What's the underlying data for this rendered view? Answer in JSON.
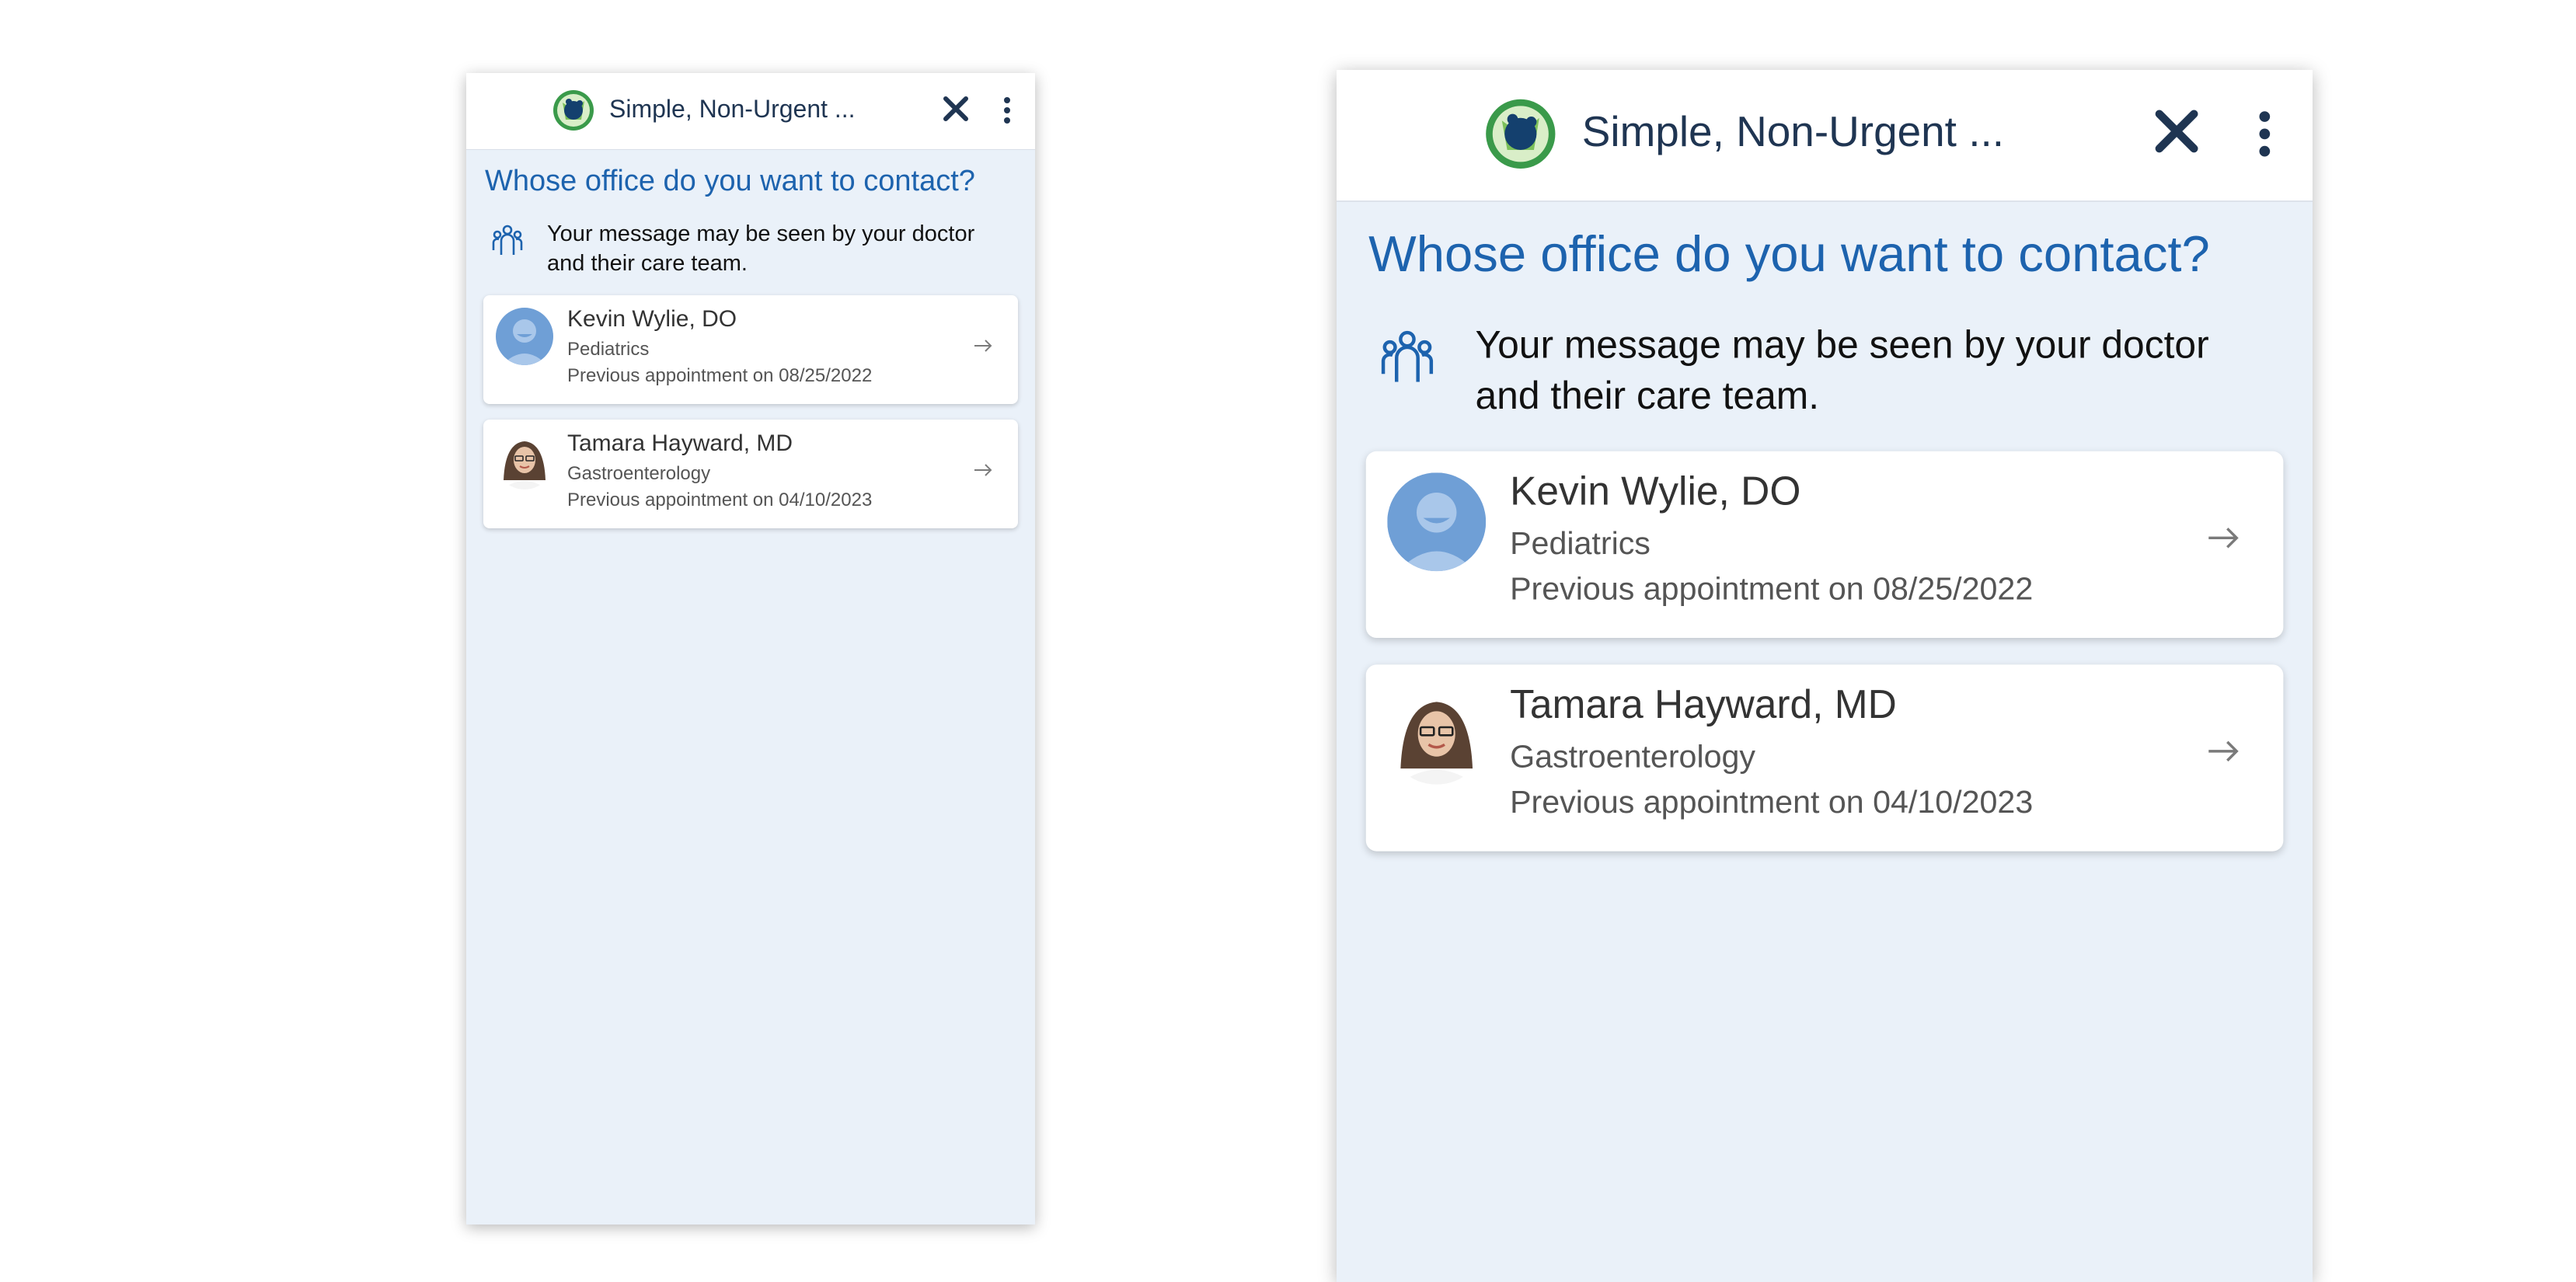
{
  "header": {
    "title": "Simple, Non-Urgent ..."
  },
  "page": {
    "heading": "Whose office do you want to contact?",
    "notice": "Your message may be seen by your doctor and their care team."
  },
  "providers": [
    {
      "name": "Kevin Wylie, DO",
      "specialty": "Pediatrics",
      "appointment": "Previous appointment on 08/25/2022",
      "avatar": "generic-person-avatar"
    },
    {
      "name": "Tamara Hayward, MD",
      "specialty": "Gastroenterology",
      "appointment": "Previous appointment on 04/10/2023",
      "avatar": "photo-avatar"
    }
  ],
  "colors": {
    "heading": "#1d63ae",
    "background": "#eaf1f9",
    "header_text": "#1f3552",
    "close_icon": "#1f3552"
  }
}
